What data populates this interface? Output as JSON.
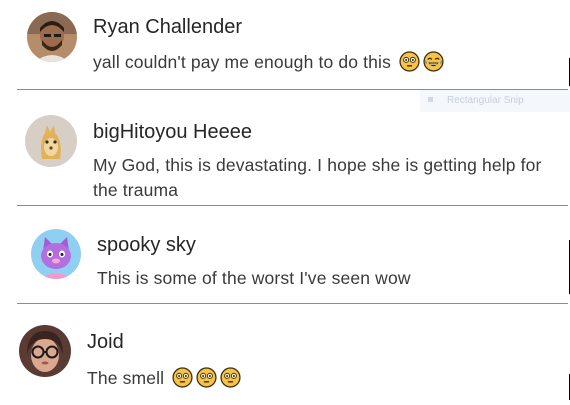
{
  "comments": [
    {
      "username": "Ryan Challender",
      "text": "yall couldn't pay me enough to do this",
      "emojis": [
        "flushed-face",
        "tears-of-joy-face"
      ],
      "avatar": "person-with-beard"
    },
    {
      "username": "bigHitoyou Heeee",
      "text": "My God, this is devastating. I hope she is getting help for the trauma",
      "emojis": [],
      "avatar": "cartoon-character"
    },
    {
      "username": "spooky sky",
      "text": "This is some of the worst I've seen wow",
      "emojis": [],
      "avatar": "purple-cat-character"
    },
    {
      "username": "Joid",
      "text": "The smell",
      "emojis": [
        "flushed-face",
        "flushed-face",
        "flushed-face"
      ],
      "avatar": "person-with-glasses"
    }
  ],
  "overlay": {
    "snip_label": "Rectangular Snip"
  },
  "colors": {
    "username": "#262626",
    "text": "#3a3a3a",
    "divider": "#8c8c8c",
    "emoji": "#f6c343"
  }
}
